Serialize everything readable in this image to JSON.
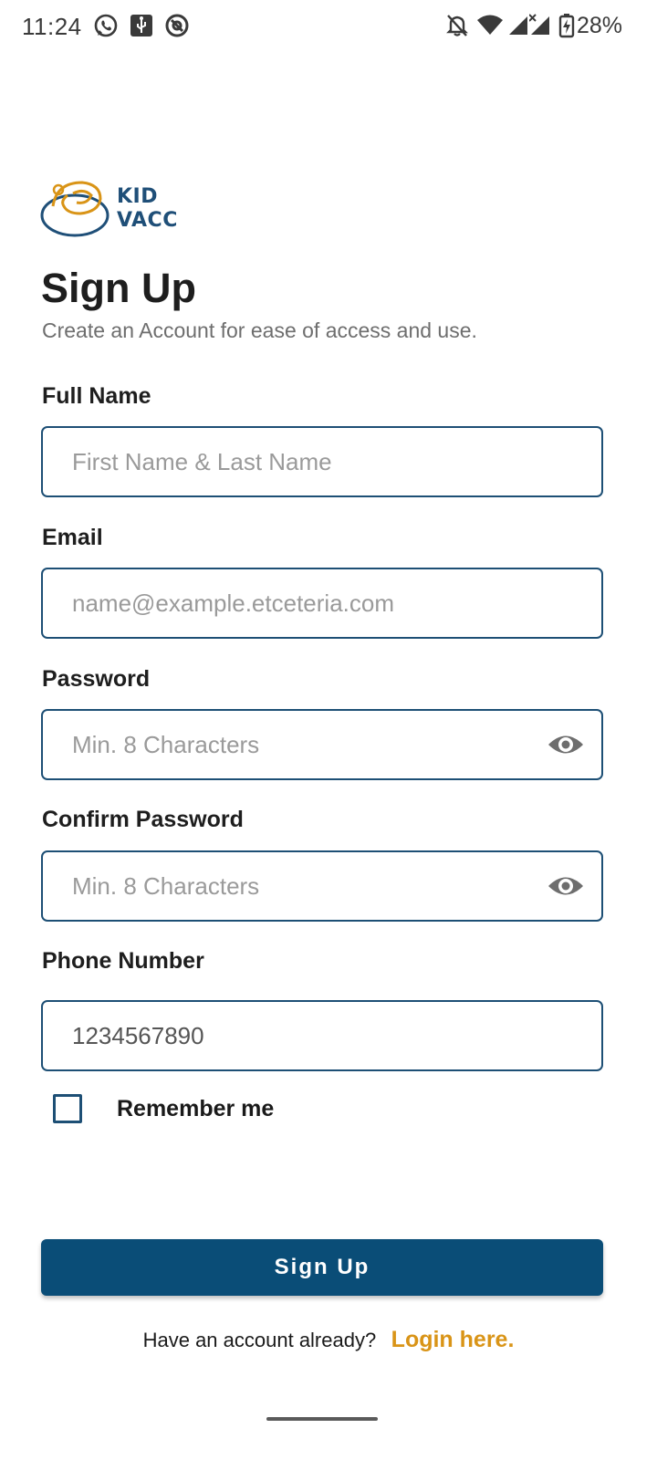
{
  "status_bar": {
    "time": "11:24",
    "battery_percent": "28%",
    "icons": [
      "whatsapp-icon",
      "usb-icon",
      "at-sign-icon",
      "bell-off-icon",
      "wifi-icon",
      "signal-icon",
      "signal-x-icon",
      "battery-charging-icon"
    ]
  },
  "logo": {
    "line1": "KID",
    "line2": "VACC",
    "colors": {
      "text": "#1f4f78",
      "accent": "#d99417"
    }
  },
  "header": {
    "title": "Sign Up",
    "subtitle": "Create an Account for ease of access and use."
  },
  "form": {
    "full_name": {
      "label": "Full Name",
      "placeholder": "First Name & Last Name",
      "value": ""
    },
    "email": {
      "label": "Email",
      "placeholder": "name@example.etceteria.com",
      "value": ""
    },
    "password": {
      "label": "Password",
      "placeholder": "Min. 8 Characters",
      "value": ""
    },
    "confirm_password": {
      "label": "Confirm Password",
      "placeholder": "Min. 8 Characters",
      "value": ""
    },
    "phone": {
      "label": "Phone Number",
      "placeholder": "",
      "value": "1234567890"
    },
    "remember_me": {
      "label": "Remember me",
      "checked": false
    }
  },
  "actions": {
    "signup_label": "Sign Up",
    "login_question": "Have an account already?",
    "login_link": "Login here."
  },
  "colors": {
    "primary": "#0a4d77",
    "border": "#1d4f75",
    "link": "#d99417"
  }
}
